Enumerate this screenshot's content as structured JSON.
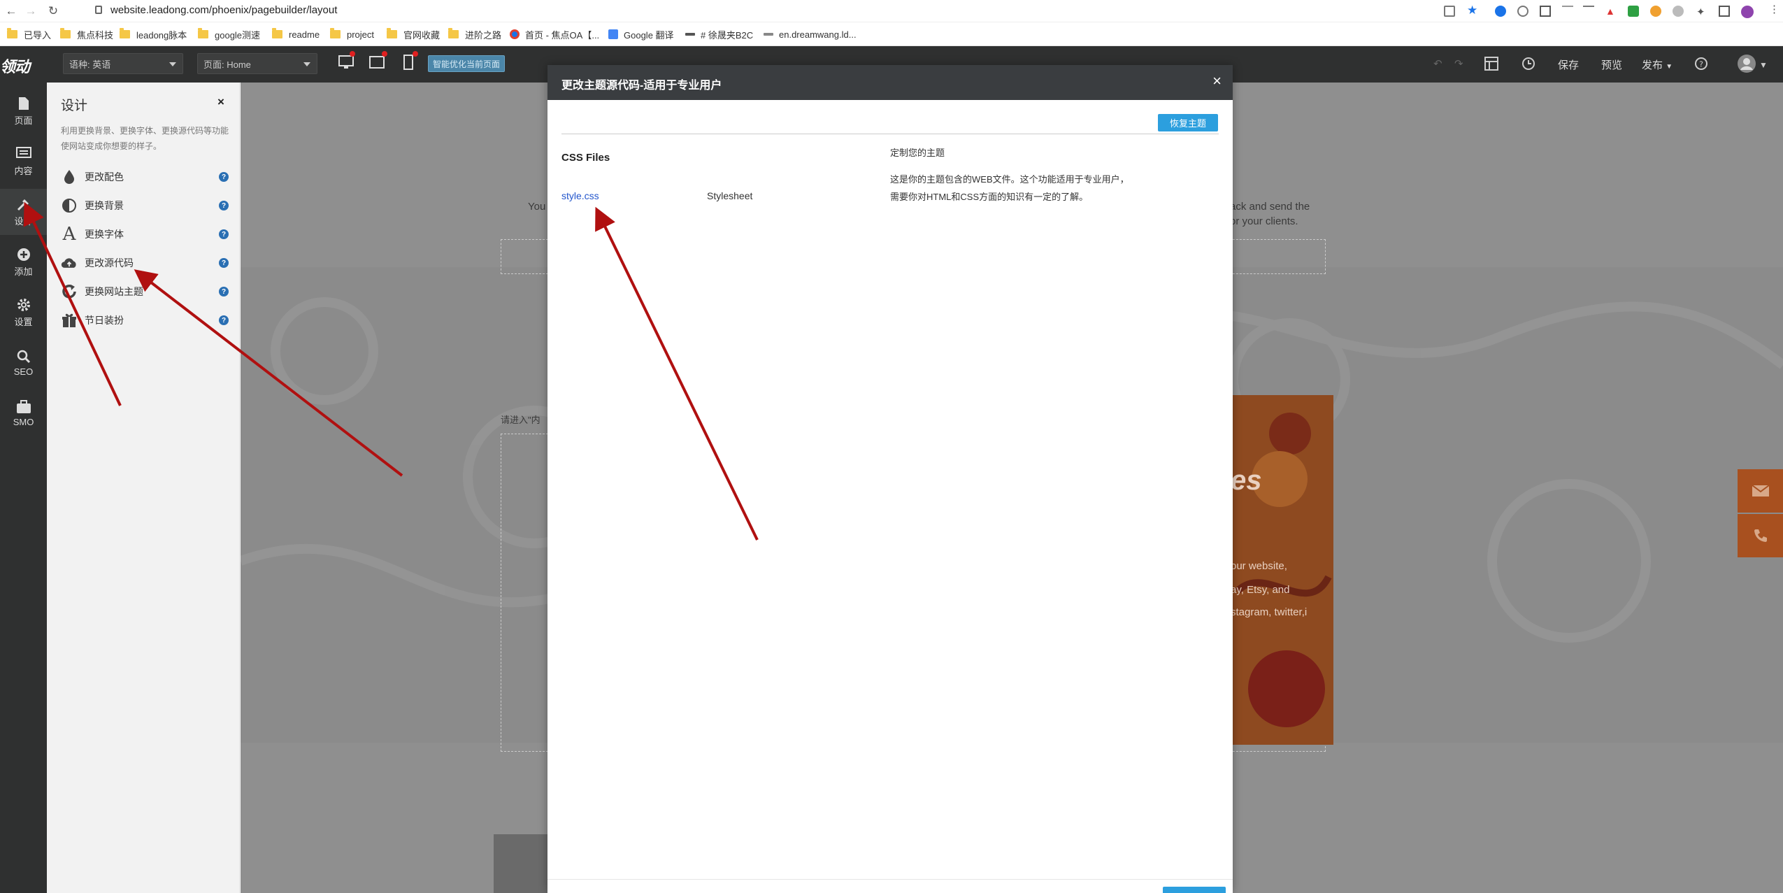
{
  "browser": {
    "url": "website.leadong.com/phoenix/pagebuilder/layout",
    "bookmarks": [
      {
        "label": "已导入",
        "kind": "folder"
      },
      {
        "label": "焦点科技",
        "kind": "folder"
      },
      {
        "label": "leadong脉本",
        "kind": "folder"
      },
      {
        "label": "google测速",
        "kind": "folder"
      },
      {
        "label": "readme",
        "kind": "folder"
      },
      {
        "label": "project",
        "kind": "folder"
      },
      {
        "label": "官网收藏",
        "kind": "folder"
      },
      {
        "label": "进阶之路",
        "kind": "folder"
      },
      {
        "label": "首页 - 焦点OA【...",
        "kind": "site"
      },
      {
        "label": "Google 翻译",
        "kind": "site"
      },
      {
        "label": "# 徐晟夹B2C",
        "kind": "site"
      },
      {
        "label": "en.dreamwang.ld...",
        "kind": "site"
      }
    ]
  },
  "appbar": {
    "logo": "领动",
    "language_select": "语种: 英语",
    "page_select": "页面: Home",
    "smart_button": "智能优化当前页面",
    "save": "保存",
    "preview": "预览",
    "publish": "发布"
  },
  "leftnav": [
    {
      "label": "页面",
      "icon": "page-icon"
    },
    {
      "label": "内容",
      "icon": "content-icon"
    },
    {
      "label": "设计",
      "icon": "design-icon"
    },
    {
      "label": "添加",
      "icon": "add-icon"
    },
    {
      "label": "设置",
      "icon": "gear-icon"
    },
    {
      "label": "SEO",
      "icon": "search-icon"
    },
    {
      "label": "SMO",
      "icon": "briefcase-icon"
    }
  ],
  "panel": {
    "title": "设计",
    "close": "×",
    "description": "利用更换背景、更换字体、更换源代码等功能使网站变成你想要的样子。",
    "items": [
      {
        "label": "更改配色",
        "icon": "droplet-icon"
      },
      {
        "label": "更换背景",
        "icon": "contrast-icon"
      },
      {
        "label": "更换字体",
        "icon": "font-icon"
      },
      {
        "label": "更改源代码",
        "icon": "cloud-upload-icon"
      },
      {
        "label": "更换网站主题",
        "icon": "refresh-icon"
      },
      {
        "label": "节日装扮",
        "icon": "gift-icon"
      }
    ],
    "help": "?"
  },
  "background": {
    "text_you": "You",
    "text_send_1": "ack and send the",
    "text_send_2": "or your clients.",
    "text_enter": "请进入\"内",
    "text_es": "es",
    "text_web_1": "our website,",
    "text_web_2": "ay, Etsy, and",
    "text_web_3": "stagram, twitter,i"
  },
  "modal": {
    "title": "更改主题源代码-适用于专业用户",
    "close": "×",
    "restore_button": "恢复主题",
    "css_files_heading": "CSS Files",
    "file_name": "style.css",
    "file_type": "Stylesheet",
    "customize_title": "定制您的主题",
    "customize_desc_1": "这是你的主题包含的WEB文件。这个功能适用于专业用户，",
    "customize_desc_2": "需要你对HTML和CSS方面的知识有一定的了解。"
  },
  "colors": {
    "accent": "#2c9fde",
    "dark_bar": "#2f3030",
    "annotation_arrow": "#b01010",
    "link": "#2255cc"
  }
}
